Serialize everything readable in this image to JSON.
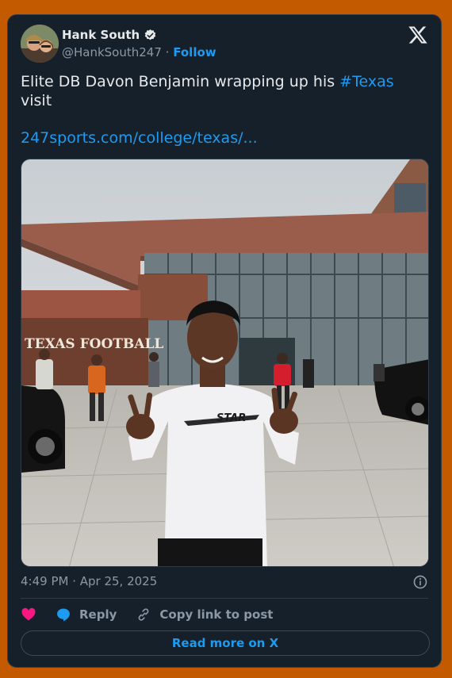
{
  "author": {
    "name": "Hank South",
    "handle": "@HankSouth247",
    "separator": "·",
    "follow_label": "Follow"
  },
  "tweet": {
    "text_before": "Elite DB Davon Benjamin wrapping up his ",
    "hashtag": "#Texas",
    "text_after": " visit",
    "link": "247sports.com/college/texas/..."
  },
  "photo": {
    "building_sign": "TEXAS FOOTBALL",
    "shirt_logo": "STAR"
  },
  "meta": {
    "timestamp": "4:49 PM · Apr 25, 2025"
  },
  "actions": {
    "reply_label": "Reply",
    "copy_label": "Copy link to post"
  },
  "read_more_label": "Read more on X",
  "colors": {
    "page_background": "#c35a00",
    "card_background": "#15202b",
    "accent": "#1d9bf0",
    "like": "#f91880"
  }
}
